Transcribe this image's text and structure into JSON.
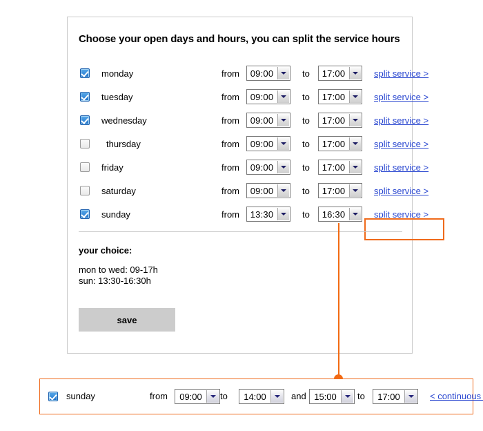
{
  "main_panel": {
    "heading": "Choose your open days and hours, you can split the service hours",
    "labels": {
      "from": "from",
      "to": "to",
      "split_link": "split service >"
    },
    "rows": [
      {
        "day": "monday",
        "checked": true,
        "from": "09:00",
        "to": "17:00",
        "split_link": "split service >"
      },
      {
        "day": "tuesday",
        "checked": true,
        "from": "09:00",
        "to": "17:00",
        "split_link": "split service >"
      },
      {
        "day": "wednesday",
        "checked": true,
        "from": "09:00",
        "to": "17:00",
        "split_link": "split service >"
      },
      {
        "day": "thursday",
        "checked": false,
        "from": "09:00",
        "to": "17:00",
        "split_link": "split service >"
      },
      {
        "day": "friday",
        "checked": false,
        "from": "09:00",
        "to": "17:00",
        "split_link": "split service >"
      },
      {
        "day": "saturday",
        "checked": false,
        "from": "09:00",
        "to": "17:00",
        "split_link": "split service >"
      },
      {
        "day": "sunday",
        "checked": true,
        "from": "13:30",
        "to": "16:30",
        "split_link": "split service >"
      }
    ],
    "summary": {
      "title": "your choice:",
      "line1": "mon to wed: 09-17h",
      "line2": "sun: 13:30-16:30h"
    },
    "save_label": "save"
  },
  "bottom_panel": {
    "day": "sunday",
    "checked": true,
    "label_from": "from",
    "label_to_1": "to",
    "label_and": "and",
    "label_to_2": "to",
    "slot1_from": "09:00",
    "slot1_to": "14:00",
    "slot2_from": "15:00",
    "slot2_to": "17:00",
    "continuous_link": "< continuous service"
  },
  "colors": {
    "accent_orange": "#ef6a1b",
    "link_blue": "#2a47d0",
    "panel_border": "#c9c9c9",
    "save_bg": "#cccccc",
    "checkbox_blue": "#3f92dd"
  }
}
